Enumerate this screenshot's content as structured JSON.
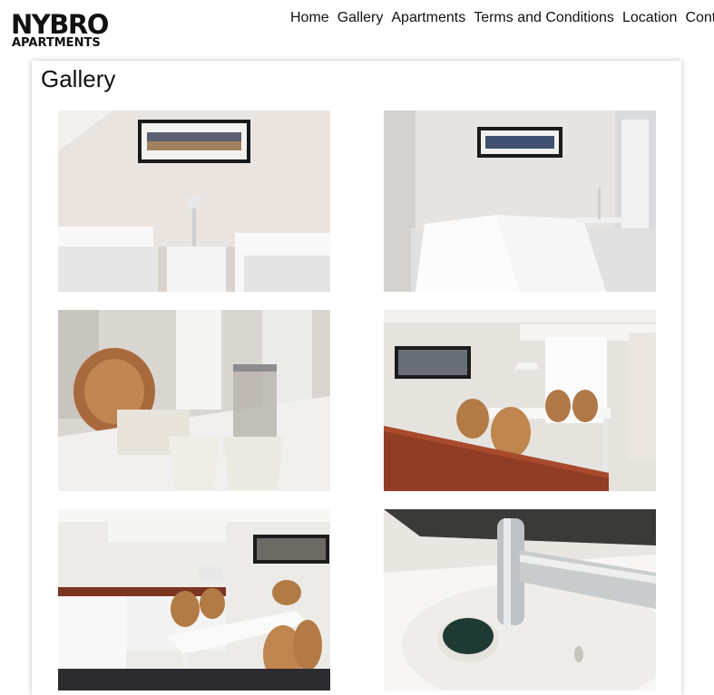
{
  "header": {
    "logo_line1": "NYBRO",
    "logo_line2": "APARTMENTS",
    "nav": [
      "Home",
      "Gallery",
      "Apartments",
      "Terms and Conditions",
      "Location",
      "Cont"
    ]
  },
  "gallery": {
    "title": "Gallery"
  }
}
